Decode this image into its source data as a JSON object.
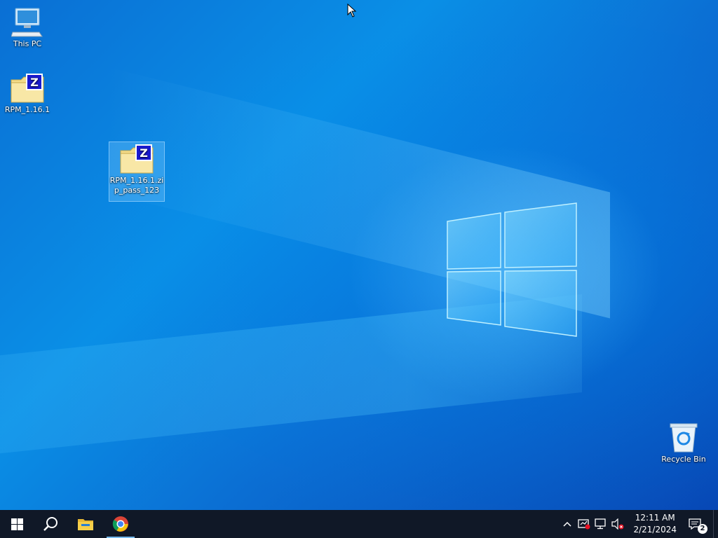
{
  "desktop": {
    "icons": [
      {
        "label": "This PC",
        "icon": "this-pc-icon"
      },
      {
        "label": "RPM_1.16.1",
        "icon": "zip-folder-icon"
      },
      {
        "label": "RPM_1.16.1.zip_pass_123",
        "icon": "zip-folder-icon",
        "selected": true
      },
      {
        "label": "Recycle Bin",
        "icon": "recycle-bin-icon"
      }
    ]
  },
  "taskbar": {
    "pinned": [
      {
        "name": "start",
        "icon": "windows-logo-icon"
      },
      {
        "name": "search",
        "icon": "search-icon"
      },
      {
        "name": "file-explorer",
        "icon": "folder-icon"
      },
      {
        "name": "chrome",
        "icon": "chrome-icon",
        "active": true
      }
    ],
    "tray": {
      "icons": [
        "chevron-up-icon",
        "security-alert-icon",
        "network-icon",
        "volume-muted-icon"
      ],
      "time": "12:11 AM",
      "date": "2/21/2024",
      "notification_count": "2"
    }
  },
  "colors": {
    "accent": "#0078d7",
    "taskbar": "#101827",
    "active_indicator": "#76b9ed"
  }
}
